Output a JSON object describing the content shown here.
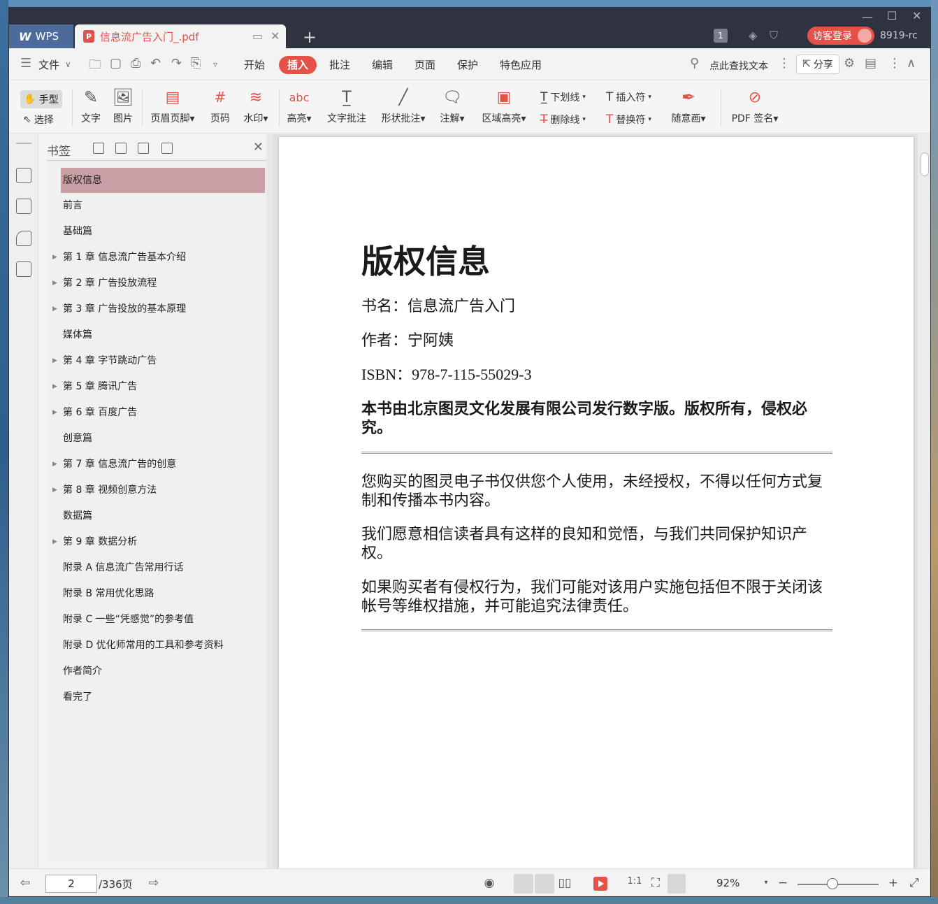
{
  "app": {
    "brand": "WPS",
    "doc_tab": "信息流广告入门_.pdf",
    "window_badge": "1",
    "login": "访客登录",
    "user": "8919-rc"
  },
  "menu": {
    "file": "文件",
    "items": [
      "开始",
      "插入",
      "批注",
      "编辑",
      "页面",
      "保护",
      "特色应用"
    ],
    "active": "插入",
    "search": "点此查找文本",
    "share": "分享"
  },
  "ribbon": {
    "hand": "手型",
    "select": "选择",
    "text": "文字",
    "image": "图片",
    "header_footer": "页眉页脚",
    "page_number": "页码",
    "watermark": "水印",
    "highlight": "高亮",
    "text_comment": "文字批注",
    "shape_comment": "形状批注",
    "note": "注解",
    "area_highlight": "区域高亮",
    "underline": "下划线",
    "strikethrough": "删除线",
    "insert_char": "插入符",
    "replace_char": "替换符",
    "freehand": "随意画",
    "pdf_sign": "PDF 签名"
  },
  "bookmarks": {
    "title": "书签",
    "items": [
      {
        "label": "版权信息",
        "selected": true,
        "expandable": false
      },
      {
        "label": "前言",
        "expandable": false
      },
      {
        "label": "基础篇",
        "expandable": false
      },
      {
        "label": "第 1 章 信息流广告基本介绍",
        "expandable": true
      },
      {
        "label": "第 2 章 广告投放流程",
        "expandable": true
      },
      {
        "label": "第 3 章 广告投放的基本原理",
        "expandable": true
      },
      {
        "label": "媒体篇",
        "expandable": false
      },
      {
        "label": "第 4 章 字节跳动广告",
        "expandable": true
      },
      {
        "label": "第 5 章 腾讯广告",
        "expandable": true
      },
      {
        "label": "第 6 章 百度广告",
        "expandable": true
      },
      {
        "label": "创意篇",
        "expandable": false
      },
      {
        "label": "第 7 章 信息流广告的创意",
        "expandable": true
      },
      {
        "label": "第 8 章 视频创意方法",
        "expandable": true
      },
      {
        "label": "数据篇",
        "expandable": false
      },
      {
        "label": "第 9 章 数据分析",
        "expandable": true
      },
      {
        "label": "附录 A 信息流广告常用行话",
        "expandable": false
      },
      {
        "label": "附录 B 常用优化思路",
        "expandable": false
      },
      {
        "label": "附录 C 一些“凭感觉”的参考值",
        "expandable": false
      },
      {
        "label": "附录 D 优化师常用的工具和参考资料",
        "expandable": false
      },
      {
        "label": "作者简介",
        "expandable": false
      },
      {
        "label": "看完了",
        "expandable": false
      }
    ]
  },
  "document": {
    "heading": "版权信息",
    "book_name": "书名：信息流广告入门",
    "author": "作者：宁阿姨",
    "isbn": "ISBN：978-7-115-55029-3",
    "publisher_note": "本书由北京图灵文化发展有限公司发行数字版。版权所有，侵权必究。",
    "para1": "您购买的图灵电子书仅供您个人使用，未经授权，不得以任何方式复制和传播本书内容。",
    "para2": "我们愿意相信读者具有这样的良知和觉悟，与我们共同保护知识产权。",
    "para3": "如果购买者有侵权行为，我们可能对该用户实施包括但不限于关闭该帐号等维权措施，并可能追究法律责任。"
  },
  "status": {
    "current_page": "2",
    "total_pages": "/336页",
    "zoom": "92%"
  },
  "colors": {
    "accent": "#e45149",
    "titlebar": "#2f3340",
    "bookmark_selected": "#c99fa5"
  }
}
